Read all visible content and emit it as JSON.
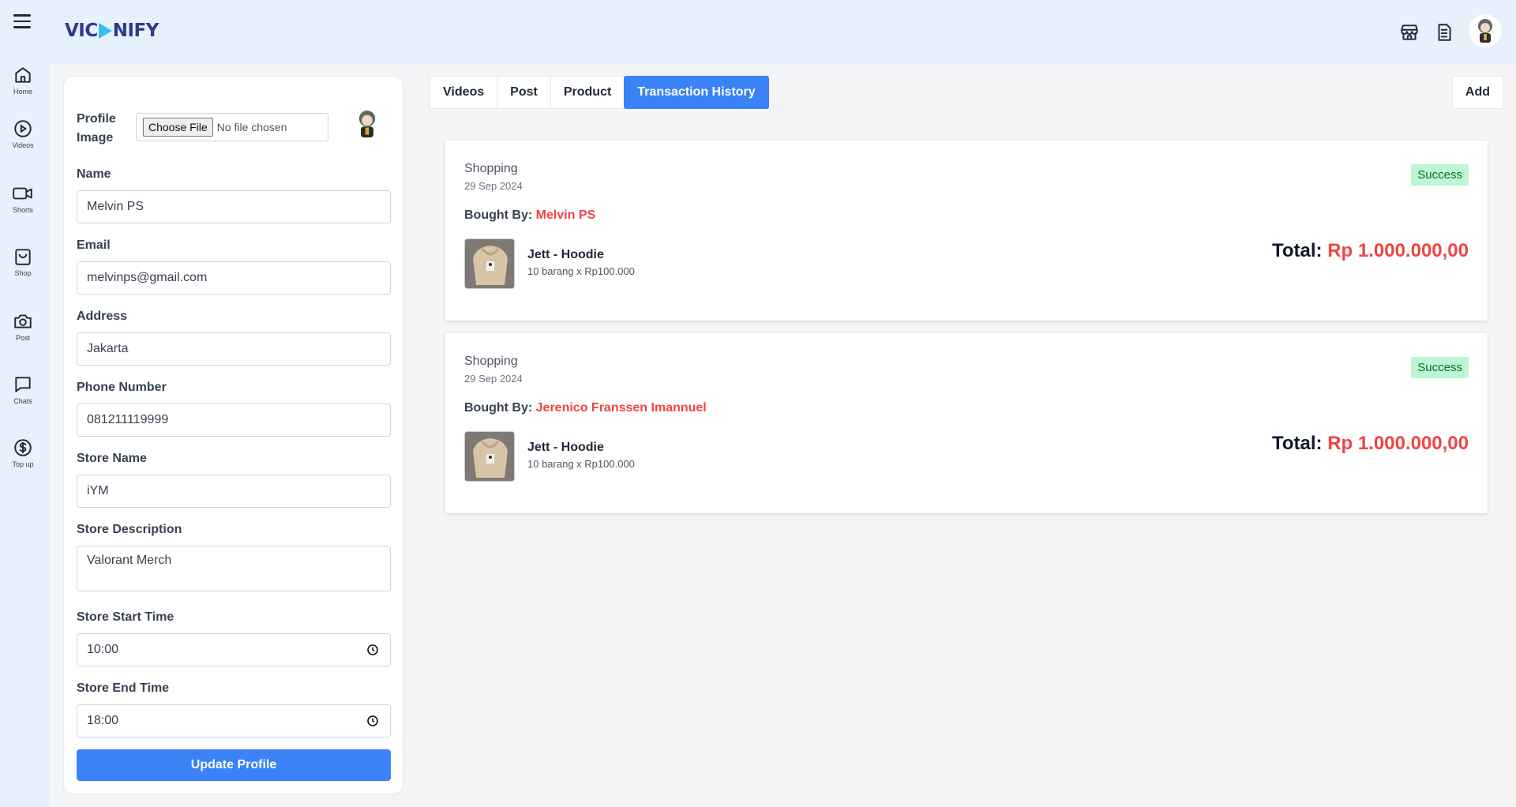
{
  "header": {
    "logo_left": "VIC",
    "logo_right": "NIFY"
  },
  "sidebar": {
    "items": [
      {
        "label": "Home",
        "icon": "home-icon"
      },
      {
        "label": "Videos",
        "icon": "play-circle-icon"
      },
      {
        "label": "Shorts",
        "icon": "video-camera-icon"
      },
      {
        "label": "Shop",
        "icon": "shopping-bag-icon"
      },
      {
        "label": "Post",
        "icon": "camera-icon"
      },
      {
        "label": "Chats",
        "icon": "chat-icon"
      },
      {
        "label": "Top up",
        "icon": "dollar-icon"
      }
    ]
  },
  "profile": {
    "image_label": "Profile Image",
    "file_button": "Choose File",
    "file_status": "No file chosen",
    "fields": {
      "name": {
        "label": "Name",
        "value": "Melvin PS"
      },
      "email": {
        "label": "Email",
        "value": "melvinps@gmail.com"
      },
      "address": {
        "label": "Address",
        "value": "Jakarta"
      },
      "phone": {
        "label": "Phone Number",
        "value": "081211119999"
      },
      "store_name": {
        "label": "Store Name",
        "value": "iYM"
      },
      "store_description": {
        "label": "Store Description",
        "value": "Valorant Merch"
      },
      "store_start": {
        "label": "Store Start Time",
        "value": "10:00"
      },
      "store_end": {
        "label": "Store End Time",
        "value": "18:00"
      }
    },
    "update_button": "Update Profile"
  },
  "tabs": {
    "items": [
      "Videos",
      "Post",
      "Product",
      "Transaction History"
    ],
    "active": "Transaction History",
    "add_button": "Add"
  },
  "transactions": [
    {
      "type": "Shopping",
      "date": "29 Sep 2024",
      "status": "Success",
      "bought_by_label": "Bought By:",
      "buyer": "Melvin PS",
      "product": "Jett - Hoodie",
      "quantity": "10 barang x Rp100.000",
      "total_label": "Total:",
      "total": "Rp 1.000.000,00"
    },
    {
      "type": "Shopping",
      "date": "29 Sep 2024",
      "status": "Success",
      "bought_by_label": "Bought By:",
      "buyer": "Jerenico Franssen Imannuel",
      "product": "Jett - Hoodie",
      "quantity": "10 barang x Rp100.000",
      "total_label": "Total:",
      "total": "Rp 1.000.000,00"
    }
  ],
  "colors": {
    "accent": "#3b82f6",
    "highlight": "#ef4444",
    "success_bg": "#bbf7d0",
    "header_bg": "#e6f1fb"
  }
}
